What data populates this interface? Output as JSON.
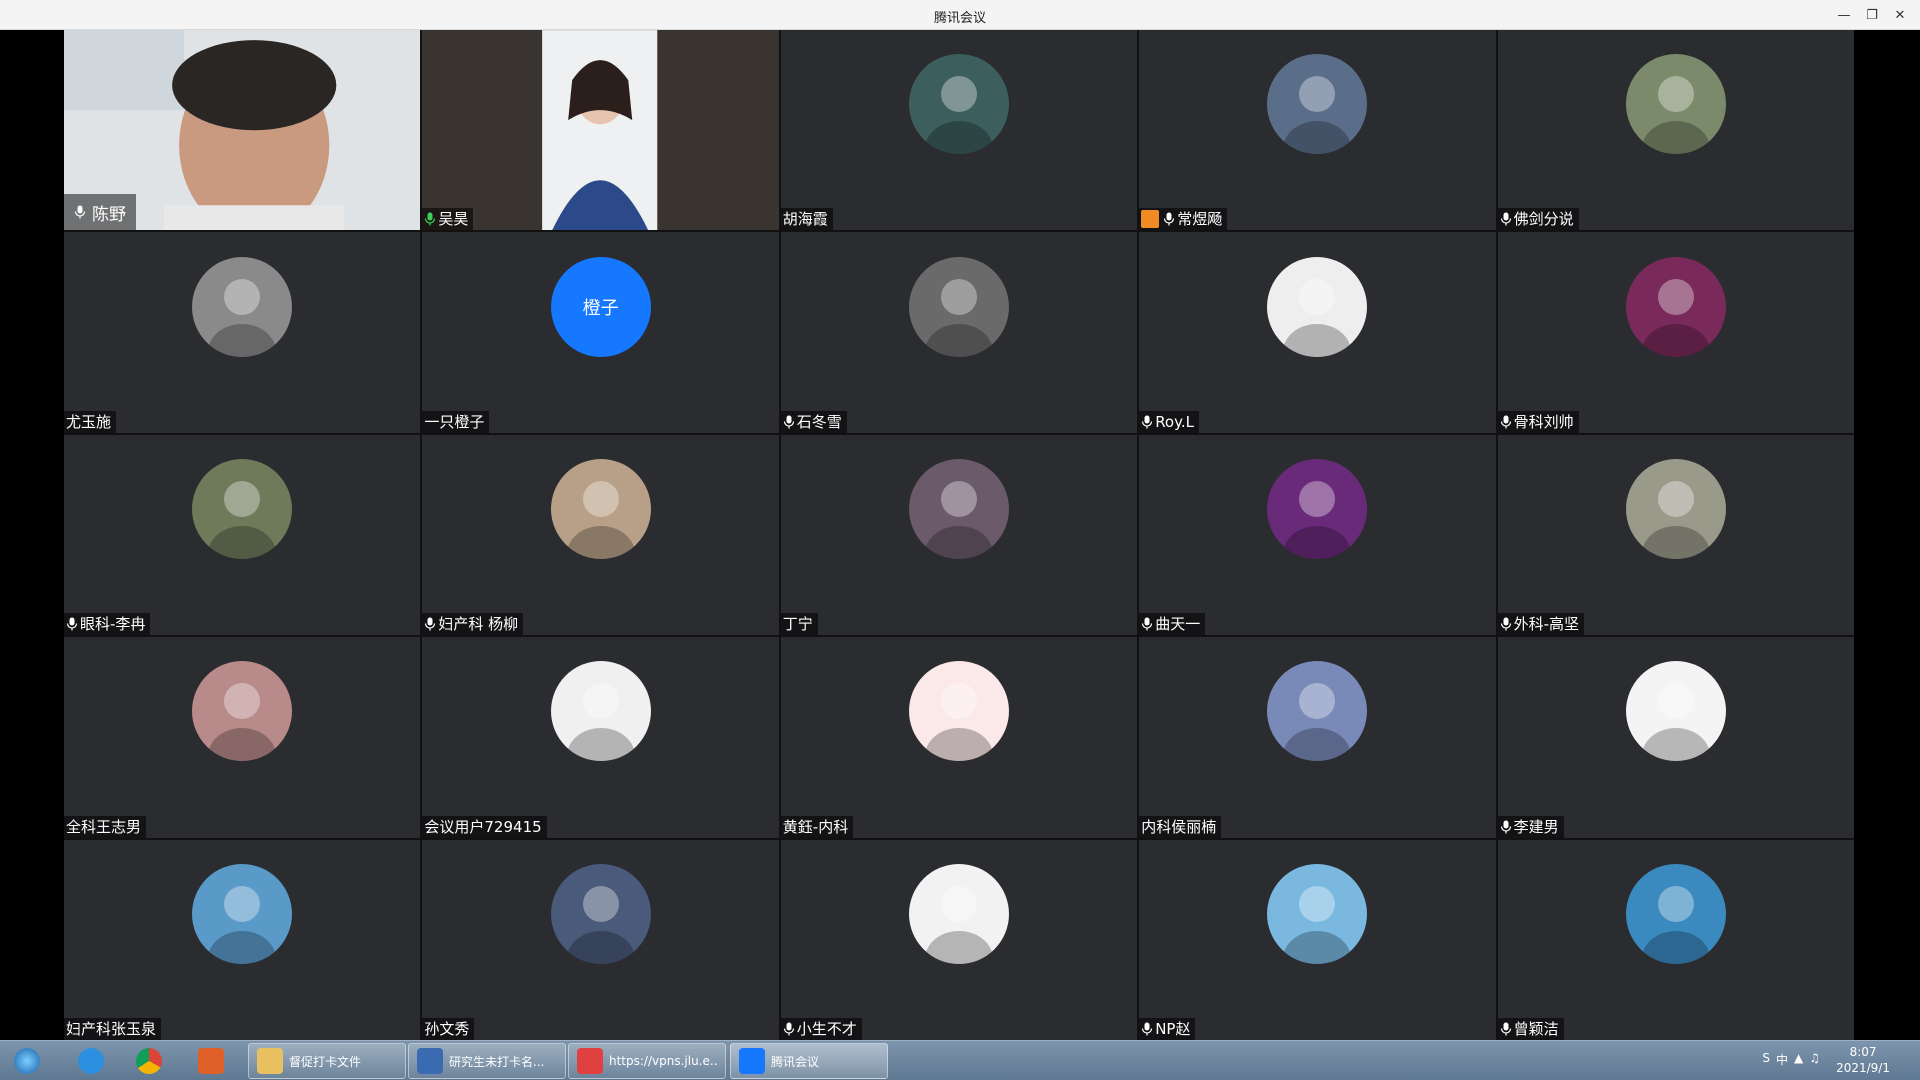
{
  "window": {
    "title": "腾讯会议",
    "controls": [
      "minimize",
      "restore",
      "close"
    ]
  },
  "participants": [
    {
      "name": "陈野",
      "type": "video",
      "mic": true
    },
    {
      "name": "吴昊",
      "type": "video",
      "mic": true,
      "mic_color": "#3bd15a"
    },
    {
      "name": "胡海霞",
      "type": "avatar",
      "mic": false,
      "avatar_color": "#3c5e5c"
    },
    {
      "name": "常煜飏",
      "type": "avatar",
      "mic": true,
      "host": true,
      "avatar_color": "#5a6e8a"
    },
    {
      "name": "佛剑分说",
      "type": "avatar",
      "mic": true,
      "avatar_color": "#7a8a6a"
    },
    {
      "name": "尤玉施",
      "type": "avatar",
      "mic": false,
      "avatar_color": "#8a8a8a"
    },
    {
      "name": "一只橙子",
      "type": "initials",
      "initials": "橙子",
      "mic": false,
      "avatar_color": "#1677ff"
    },
    {
      "name": "石冬雪",
      "type": "avatar",
      "mic": true,
      "avatar_color": "#6a6a6a"
    },
    {
      "name": "Roy.L",
      "type": "avatar",
      "mic": true,
      "avatar_color": "#eeeeee"
    },
    {
      "name": "骨科刘帅",
      "type": "avatar",
      "mic": true,
      "avatar_color": "#7a2a5a"
    },
    {
      "name": "眼科-李冉",
      "type": "avatar",
      "mic": true,
      "avatar_color": "#6e7a5a"
    },
    {
      "name": "妇产科 杨柳",
      "type": "avatar",
      "mic": true,
      "avatar_color": "#b8a088"
    },
    {
      "name": "丁宁",
      "type": "avatar",
      "mic": false,
      "avatar_color": "#6a5a6a"
    },
    {
      "name": "曲天一",
      "type": "avatar",
      "mic": true,
      "avatar_color": "#6a2a7a"
    },
    {
      "name": "外科-高坚",
      "type": "avatar",
      "mic": true,
      "avatar_color": "#9a9a8a"
    },
    {
      "name": "全科王志男",
      "type": "avatar",
      "mic": false,
      "avatar_color": "#b88a8a"
    },
    {
      "name": "会议用户729415",
      "type": "avatar",
      "mic": false,
      "avatar_color": "#f0f0f0"
    },
    {
      "name": "黄鈺-内科",
      "type": "avatar",
      "mic": false,
      "avatar_color": "#fbe8e8"
    },
    {
      "name": "内科侯丽楠",
      "type": "avatar",
      "mic": false,
      "avatar_color": "#7a8ab8"
    },
    {
      "name": "李建男",
      "type": "avatar",
      "mic": true,
      "avatar_color": "#f4f4f4"
    },
    {
      "name": "妇产科张玉泉",
      "type": "avatar",
      "mic": false,
      "avatar_color": "#5a9ac8"
    },
    {
      "name": "孙文秀",
      "type": "avatar",
      "mic": false,
      "avatar_color": "#4a5a7a"
    },
    {
      "name": "小生不才",
      "type": "avatar",
      "mic": true,
      "avatar_color": "#f2f2f2"
    },
    {
      "name": "NP赵",
      "type": "avatar",
      "mic": true,
      "avatar_color": "#7ab8e0"
    },
    {
      "name": "曾颖洁",
      "type": "avatar",
      "mic": true,
      "avatar_color": "#3a8ac0"
    }
  ],
  "taskbar": {
    "pinned": [
      "ie-icon",
      "chrome-icon",
      "pdf-icon"
    ],
    "tasks": [
      {
        "label": "督促打卡文件",
        "icon_color": "#e8c060"
      },
      {
        "label": "研究生未打卡名...",
        "icon_color": "#3a6ab0"
      },
      {
        "label": "https://vpns.jlu.e...",
        "icon_color": "#e04040"
      },
      {
        "label": "腾讯会议",
        "icon_color": "#1677ff",
        "active": true
      }
    ],
    "time": "8:07",
    "date": "2021/9/1"
  }
}
